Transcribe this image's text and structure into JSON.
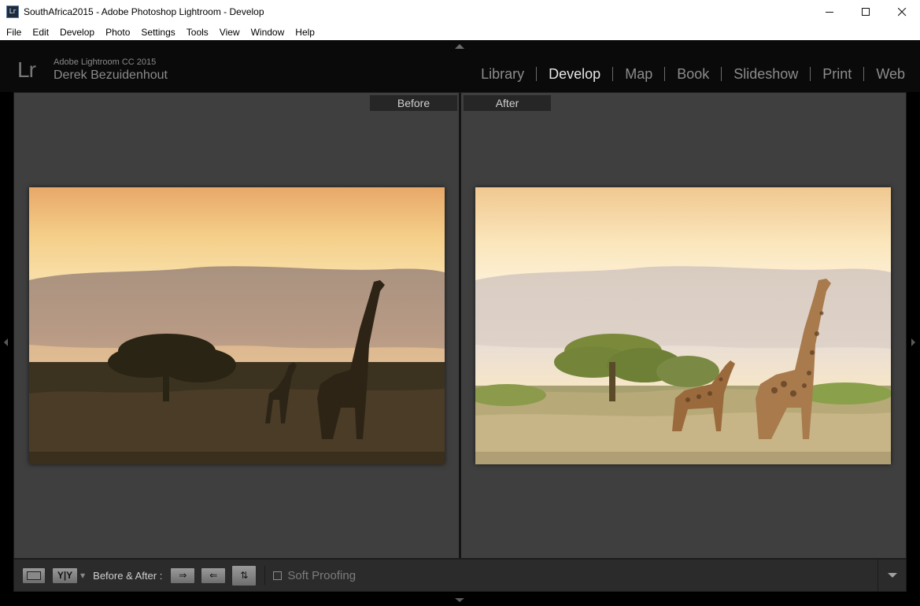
{
  "window": {
    "title": "SouthAfrica2015 - Adobe Photoshop Lightroom - Develop",
    "app_icon_text": "Lr",
    "controls": {
      "minimize": "—",
      "maximize": "☐",
      "close": "✕"
    }
  },
  "menu": {
    "items": [
      "File",
      "Edit",
      "Develop",
      "Photo",
      "Settings",
      "Tools",
      "View",
      "Window",
      "Help"
    ]
  },
  "identity": {
    "logo": "Lr",
    "product": "Adobe Lightroom CC 2015",
    "user": "Derek Bezuidenhout"
  },
  "modules": {
    "items": [
      "Library",
      "Develop",
      "Map",
      "Book",
      "Slideshow",
      "Print",
      "Web"
    ],
    "active": "Develop"
  },
  "views": {
    "before_label": "Before",
    "after_label": "After"
  },
  "toolbar": {
    "yy_label": "Y|Y",
    "before_after_label": "Before & After :",
    "copy_before_to_after_glyph": "⇒",
    "copy_after_to_before_glyph": "⇐",
    "swap_glyph": "⇅",
    "soft_proofing_label": "Soft Proofing",
    "soft_proofing_checked": false
  },
  "colors": {
    "active_module": "#e6e6e6",
    "inactive_module": "#8c8c8c",
    "panel_bg": "#3f3f3f"
  }
}
